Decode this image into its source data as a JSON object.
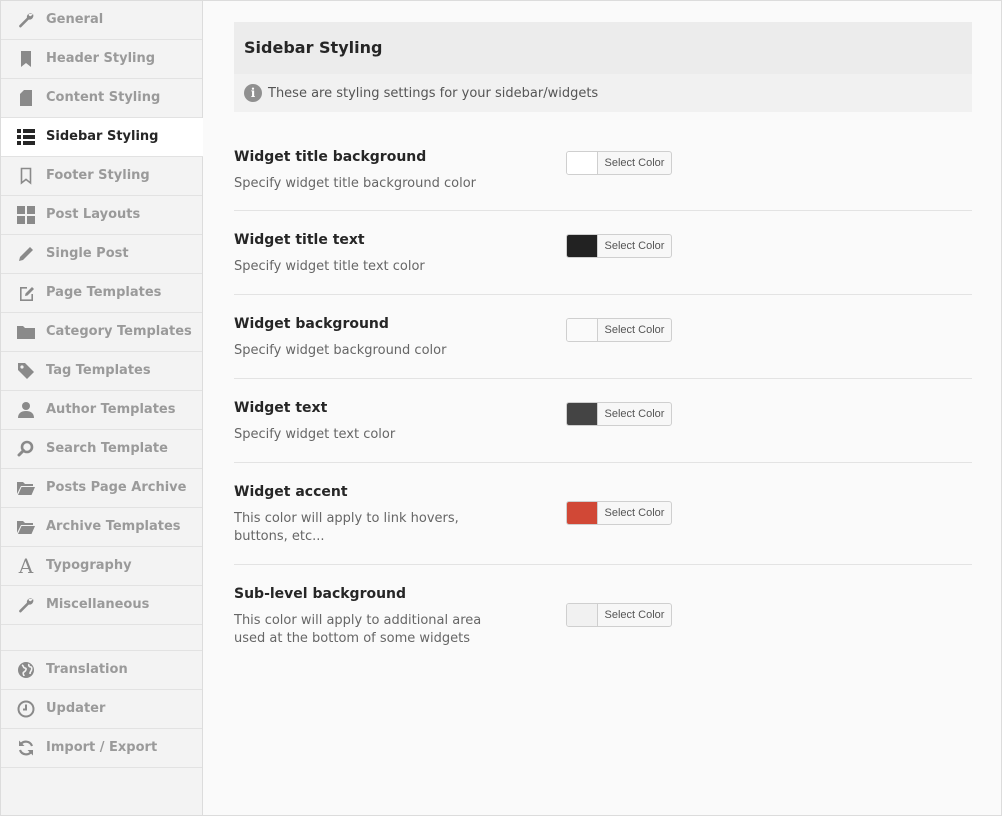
{
  "sidebar": {
    "items": [
      {
        "label": "General",
        "icon": "wrench-icon"
      },
      {
        "label": "Header Styling",
        "icon": "bookmark-icon"
      },
      {
        "label": "Content Styling",
        "icon": "document-icon"
      },
      {
        "label": "Sidebar Styling",
        "icon": "list-icon",
        "active": true
      },
      {
        "label": "Footer Styling",
        "icon": "bookmark-outline-icon"
      },
      {
        "label": "Post Layouts",
        "icon": "grid-icon"
      },
      {
        "label": "Single Post",
        "icon": "pencil-icon"
      },
      {
        "label": "Page Templates",
        "icon": "edit-icon"
      },
      {
        "label": "Category Templates",
        "icon": "folder-icon"
      },
      {
        "label": "Tag Templates",
        "icon": "tag-icon"
      },
      {
        "label": "Author Templates",
        "icon": "user-icon"
      },
      {
        "label": "Search Template",
        "icon": "search-icon"
      },
      {
        "label": "Posts Page Archive",
        "icon": "folder-open-icon"
      },
      {
        "label": "Archive Templates",
        "icon": "folder-open-icon"
      },
      {
        "label": "Typography",
        "icon": "font-icon"
      },
      {
        "label": "Miscellaneous",
        "icon": "wrench-icon"
      }
    ],
    "items2": [
      {
        "label": "Translation",
        "icon": "globe-icon"
      },
      {
        "label": "Updater",
        "icon": "clock-icon"
      },
      {
        "label": "Import / Export",
        "icon": "refresh-icon"
      }
    ]
  },
  "main": {
    "title": "Sidebar Styling",
    "info": "These are styling settings for your sidebar/widgets",
    "settings": [
      {
        "title": "Widget title background",
        "desc": "Specify widget title background color",
        "color": "#ffffff",
        "button": "Select Color"
      },
      {
        "title": "Widget title text",
        "desc": "Specify widget title text color",
        "color": "#222222",
        "button": "Select Color"
      },
      {
        "title": "Widget background",
        "desc": "Specify widget background color",
        "color": "#fafafa",
        "button": "Select Color"
      },
      {
        "title": "Widget text",
        "desc": "Specify widget text color",
        "color": "#444444",
        "button": "Select Color"
      },
      {
        "title": "Widget accent",
        "desc": "This color will apply to link hovers, buttons, etc...",
        "color": "#d14836",
        "button": "Select Color"
      },
      {
        "title": "Sub-level background",
        "desc": "This color will apply to additional area used at the bottom of some widgets",
        "color": "#f1f1f1",
        "button": "Select Color"
      }
    ]
  }
}
